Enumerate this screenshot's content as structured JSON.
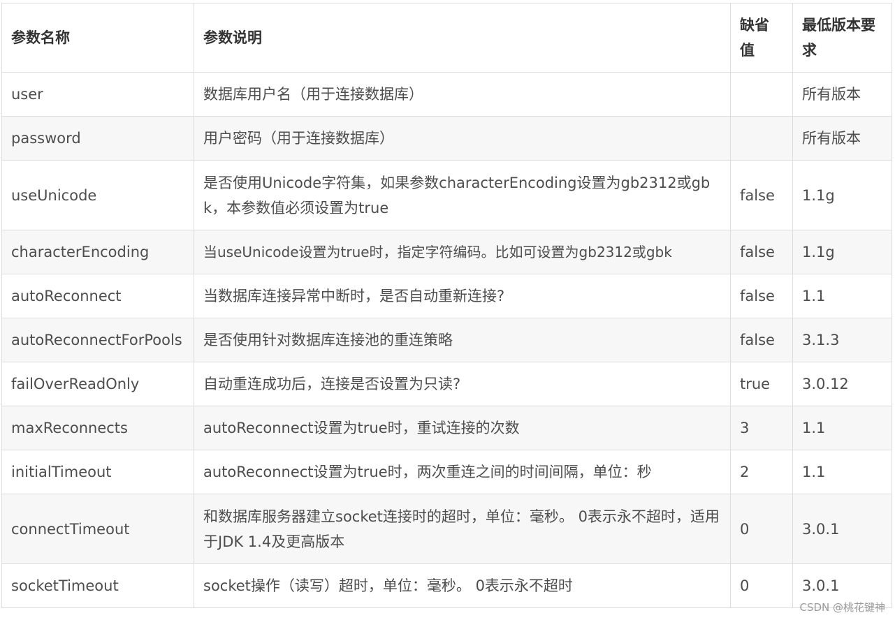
{
  "headers": {
    "name": "参数名称",
    "desc": "参数说明",
    "default": "缺省值",
    "min_version": "最低版本要求"
  },
  "rows": [
    {
      "name": "user",
      "desc": "数据库用户名（用于连接数据库）",
      "default": "",
      "min_version": "所有版本"
    },
    {
      "name": "password",
      "desc": "用户密码（用于连接数据库）",
      "default": "",
      "min_version": "所有版本"
    },
    {
      "name": "useUnicode",
      "desc": "是否使用Unicode字符集，如果参数characterEncoding设置为gb2312或gbk，本参数值必须设置为true",
      "default": "false",
      "min_version": "1.1g"
    },
    {
      "name": "characterEncoding",
      "desc": "当useUnicode设置为true时，指定字符编码。比如可设置为gb2312或gbk",
      "default": "false",
      "min_version": "1.1g"
    },
    {
      "name": "autoReconnect",
      "desc": "当数据库连接异常中断时，是否自动重新连接?",
      "default": "false",
      "min_version": "1.1"
    },
    {
      "name": "autoReconnectForPools",
      "desc": "是否使用针对数据库连接池的重连策略",
      "default": "false",
      "min_version": "3.1.3"
    },
    {
      "name": "failOverReadOnly",
      "desc": "自动重连成功后，连接是否设置为只读?",
      "default": "true",
      "min_version": "3.0.12"
    },
    {
      "name": "maxReconnects",
      "desc": "autoReconnect设置为true时，重试连接的次数",
      "default": "3",
      "min_version": "1.1"
    },
    {
      "name": "initialTimeout",
      "desc": "autoReconnect设置为true时，两次重连之间的时间间隔，单位：秒",
      "default": "2",
      "min_version": "1.1"
    },
    {
      "name": "connectTimeout",
      "desc": "和数据库服务器建立socket连接时的超时，单位：毫秒。 0表示永不超时，适用于JDK 1.4及更高版本",
      "default": "0",
      "min_version": "3.0.1"
    },
    {
      "name": "socketTimeout",
      "desc": "socket操作（读写）超时，单位：毫秒。 0表示永不超时",
      "default": "0",
      "min_version": "3.0.1"
    }
  ],
  "watermark": "CSDN @桃花键神"
}
